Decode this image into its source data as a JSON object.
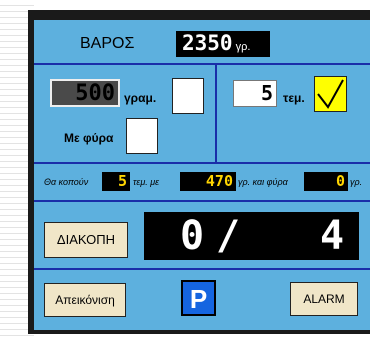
{
  "weight": {
    "label": "ΒΑΡΟΣ",
    "value": "2350",
    "unit": "γρ."
  },
  "grams": {
    "value": "500",
    "unit": "γραμ."
  },
  "tare": {
    "label": "Με φύρα"
  },
  "count": {
    "value": "5",
    "unit": "τεμ."
  },
  "result": {
    "prefix": "Θα κοπούν",
    "pieces": "5",
    "pieces_suffix": "τεμ. με",
    "grams": "470",
    "grams_suffix": "γρ. και φύρα",
    "waste": "0",
    "waste_unit": "γρ."
  },
  "stop_button": "ΔΙΑΚΟΠΗ",
  "progress": {
    "current": "0",
    "separator": "/",
    "total": "4"
  },
  "view_button": "Απεικόνιση",
  "parking_label": "P",
  "alarm_button": "ALARM",
  "colors": {
    "panel": "#5db0de",
    "lcd_digits": "#ffd500",
    "divider": "#1a2ea8",
    "check": "#ffff00",
    "parking": "#1565e0"
  }
}
